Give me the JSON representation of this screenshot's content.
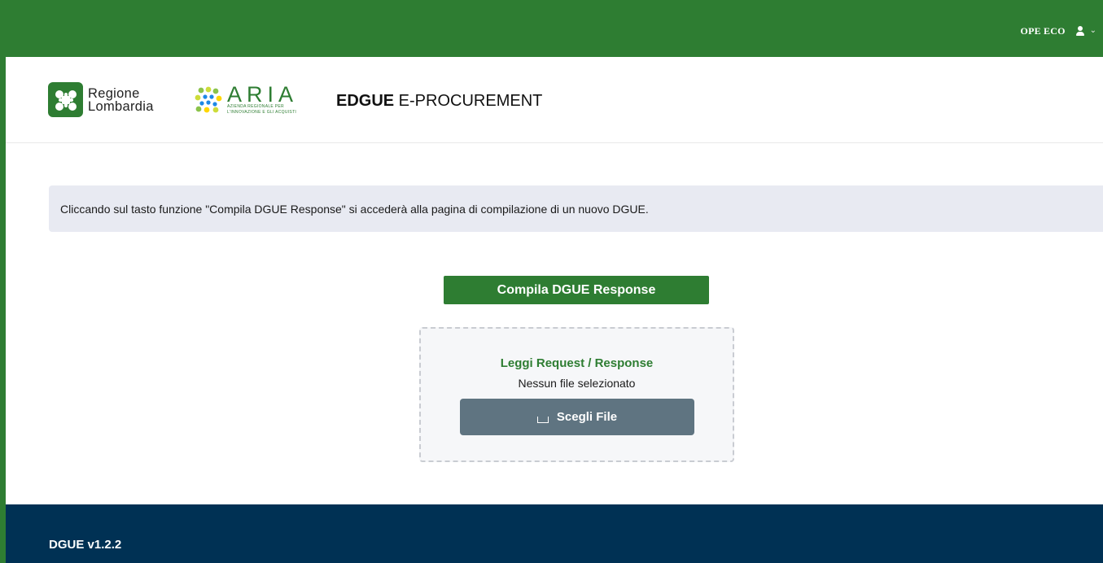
{
  "topbar": {
    "user_name": "OPE ECO",
    "user_icon": "user-icon",
    "chevron": "⌄",
    "accent_color": "#2e7d32"
  },
  "header": {
    "regione_line1": "Regione",
    "regione_line2": "Lombardia",
    "aria_word": "ARIA",
    "aria_sub_line1": "AZIENDA REGIONALE PER",
    "aria_sub_line2": "L'INNOVAZIONE E GLI ACQUISTI",
    "title_bold": "EDGUE",
    "title_rest": " E-PROCUREMENT"
  },
  "info": {
    "text": "Cliccando sul tasto funzione \"Compila DGUE Response\" si accederà alla pagina di compilazione di un nuovo DGUE."
  },
  "actions": {
    "compile_label": "Compila DGUE Response"
  },
  "upload": {
    "title": "Leggi Request / Response",
    "status": "Nessun file selezionato",
    "choose_label": "Scegli File",
    "choose_icon": "upload-icon"
  },
  "footer": {
    "version": "DGUE v1.2.2",
    "background_color": "#003154"
  }
}
